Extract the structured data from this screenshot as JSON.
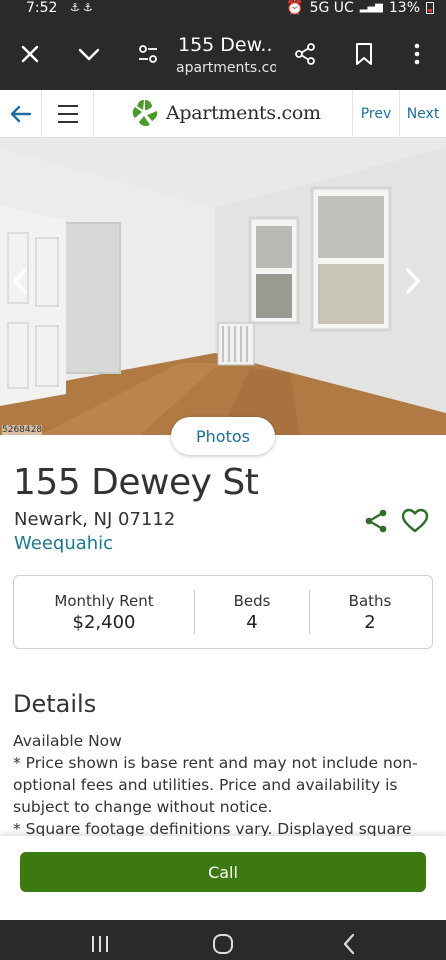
{
  "status_bar": {
    "time": "7:52",
    "notification_icons": "⚓⚓",
    "network": "5G UC",
    "battery": "13%"
  },
  "browser": {
    "title": "155 Dew...",
    "url": "apartments.com"
  },
  "site_header": {
    "logo_text": "Apartments.com",
    "prev_label": "Prev",
    "next_label": "Next"
  },
  "photo": {
    "id_label": "5268428",
    "photos_button": "Photos"
  },
  "listing": {
    "address": "155 Dewey St",
    "city": "Newark, NJ 07112",
    "neighborhood": "Weequahic",
    "stats": [
      {
        "label": "Monthly Rent",
        "value": "$2,400"
      },
      {
        "label": "Beds",
        "value": "4"
      },
      {
        "label": "Baths",
        "value": "2"
      }
    ]
  },
  "details": {
    "heading": "Details",
    "body": "Available Now\n* Price shown is base rent and may not include non-optional fees and utilities. Price and availability is subject to change without notice.\n* Square footage definitions vary. Displayed square"
  },
  "call_button": "Call",
  "colors": {
    "link": "#1a6fa0",
    "neighborhood": "#1a7a8a",
    "call": "#3c7a0f",
    "logo_green": "#4c9a2a"
  }
}
